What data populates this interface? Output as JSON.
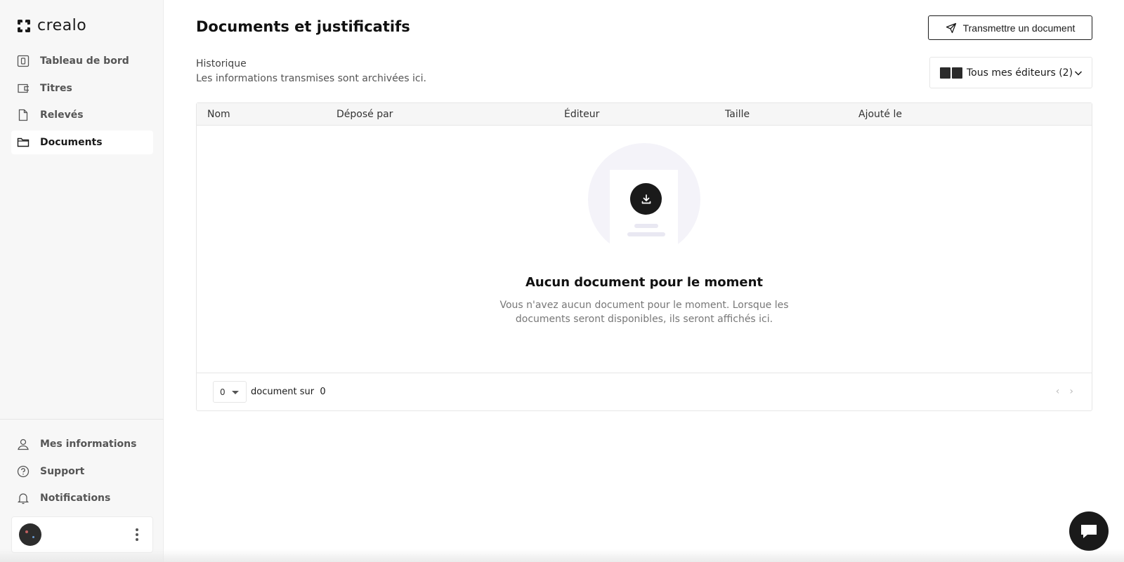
{
  "brand": {
    "name": "crealo"
  },
  "sidebar": {
    "items": [
      {
        "label": "Tableau de bord",
        "icon": "dashboard-icon",
        "active": false
      },
      {
        "label": "Titres",
        "icon": "wallet-icon",
        "active": false
      },
      {
        "label": "Relevés",
        "icon": "file-icon",
        "active": false
      },
      {
        "label": "Documents",
        "icon": "folder-icon",
        "active": true
      }
    ],
    "bottom_items": [
      {
        "label": "Mes informations",
        "icon": "user-icon"
      },
      {
        "label": "Support",
        "icon": "help-icon"
      },
      {
        "label": "Notifications",
        "icon": "bell-icon"
      }
    ]
  },
  "header": {
    "title": "Documents et justificatifs",
    "transmit_button": "Transmettre un document"
  },
  "history": {
    "title": "Historique",
    "subtitle": "Les informations transmises sont archivées ici.",
    "editor_filter": "Tous mes éditeurs (2)"
  },
  "table": {
    "columns": [
      "Nom",
      "Déposé par",
      "Éditeur",
      "Taille",
      "Ajouté le"
    ],
    "empty_title": "Aucun document pour le moment",
    "empty_description": "Vous n'avez aucun document pour le moment. Lorsque les documents seront disponibles, ils seront affichés ici.",
    "page_size": "0",
    "count_label": "document sur",
    "total": "0"
  },
  "colors": {
    "accent": "#1a1a1a",
    "sidebar_bg": "#f7f7f7",
    "illustration_bg": "#f4f3f9"
  }
}
